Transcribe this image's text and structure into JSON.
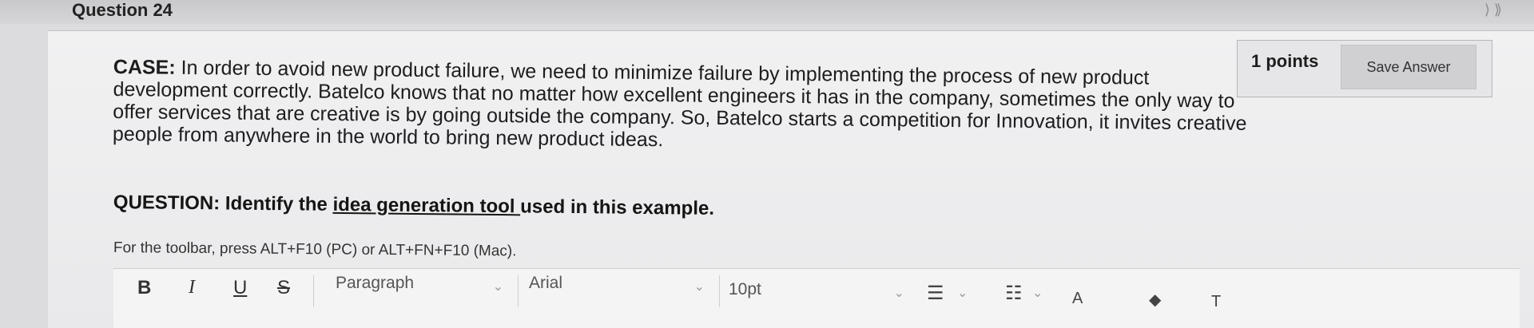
{
  "question_title": "Question 24",
  "points": "1 points",
  "save_label": "Save Answer",
  "case": {
    "label": "CASE:",
    "line1": "In order to avoid new product failure, we need to minimize failure by implementing the process of new product",
    "line2": "development correctly. Batelco knows that no matter how excellent engineers it has in the company, sometimes the only way to",
    "line3": "offer services that are creative is by going outside the company. So, Batelco starts a competition for Innovation, it invites creative",
    "line4": "people from anywhere in the world to bring new product ideas."
  },
  "question": {
    "prefix": "QUESTION: Identify the ",
    "underlined": "idea generation tool ",
    "suffix": "used in this example."
  },
  "toolbar_hint": "For the toolbar, press ALT+F10 (PC) or ALT+FN+F10 (Mac).",
  "toolbar": {
    "bold": "B",
    "italic": "I",
    "underline": "U",
    "strike": "S",
    "paragraph": "Paragraph",
    "font": "Arial",
    "size": "10pt"
  }
}
